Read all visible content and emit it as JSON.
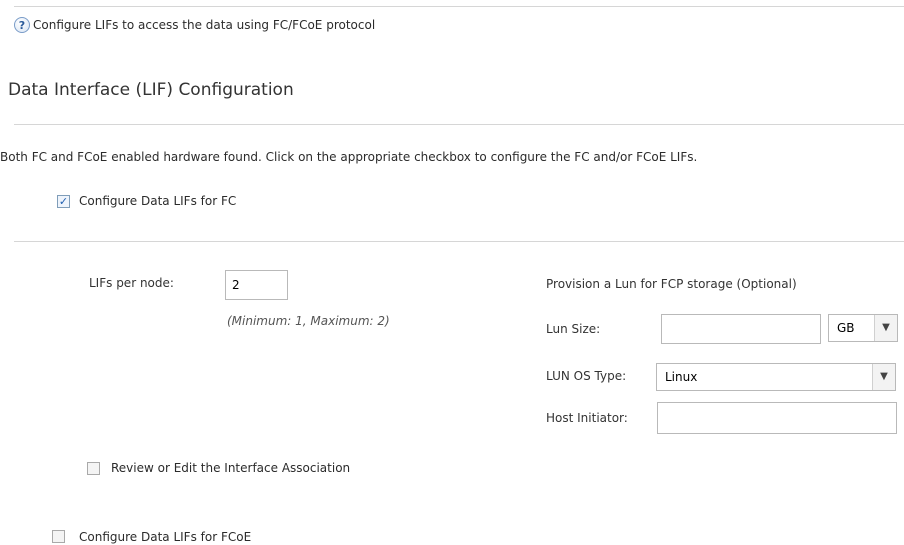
{
  "header": {
    "help_icon_glyph": "?",
    "help_text": "Configure LIFs to access the data using FC/FCoE protocol"
  },
  "section": {
    "title": "Data Interface (LIF) Configuration",
    "info_text": "Both FC and FCoE enabled hardware found. Click on the appropriate checkbox to configure the FC and/or FCoE LIFs."
  },
  "fc": {
    "checkbox_label": "Configure Data LIFs for FC",
    "checked": true,
    "lifs_per_node_label": "LIFs per node:",
    "lifs_per_node_value": "2",
    "lifs_hint": "(Minimum: 1, Maximum: 2)",
    "review_label": "Review or Edit the Interface Association",
    "review_checked": false
  },
  "provision": {
    "title": "Provision a Lun for FCP storage (Optional)",
    "lun_size_label": "Lun Size:",
    "lun_size_value": "",
    "lun_size_unit": "GB",
    "lun_os_type_label": "LUN OS Type:",
    "lun_os_type_value": "Linux",
    "host_initiator_label": "Host Initiator:",
    "host_initiator_value": ""
  },
  "fcoe": {
    "checkbox_label": "Configure Data LIFs for FCoE",
    "checked": false
  },
  "glyphs": {
    "check": "✓",
    "dropdown": "▼"
  }
}
